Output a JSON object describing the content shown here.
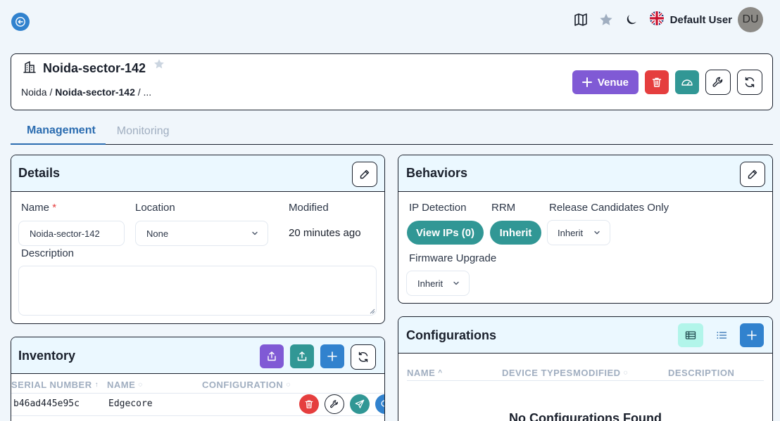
{
  "topbar": {
    "user_name": "Default User",
    "avatar_initials": "DU",
    "icons": [
      "back-icon",
      "map-icon",
      "star-icon",
      "moon-icon",
      "uk-flag-icon"
    ]
  },
  "venue": {
    "title": "Noida-sector-142",
    "breadcrumb": {
      "root": "Noida",
      "sep1": " / ",
      "current": "Noida-sector-142",
      "sep2": " / ",
      "more": "..."
    },
    "add_venue_label": "Venue"
  },
  "tabs": [
    {
      "label": "Management",
      "active": true
    },
    {
      "label": "Monitoring",
      "active": false
    }
  ],
  "details": {
    "title": "Details",
    "name_label": "Name",
    "required_mark": "*",
    "name_value": "Noida-sector-142",
    "location_label": "Location",
    "location_value": "None",
    "modified_label": "Modified",
    "modified_value": "20 minutes ago",
    "description_label": "Description",
    "description_value": ""
  },
  "behaviors": {
    "title": "Behaviors",
    "ip_detection_label": "IP Detection",
    "ip_detection_button": "View IPs (0)",
    "rrm_label": "RRM",
    "rrm_button": "Inherit",
    "release_candidates_label": "Release Candidates Only",
    "release_candidates_value": "Inherit",
    "firmware_upgrade_label": "Firmware Upgrade",
    "firmware_upgrade_value": "Inherit"
  },
  "inventory": {
    "title": "Inventory",
    "columns": [
      "SERIAL NUMBER",
      "NAME",
      "CONFIGURATION"
    ],
    "rows": [
      {
        "serial": "b46ad445e95c",
        "name": "Edgecore",
        "configuration": ""
      }
    ]
  },
  "configurations": {
    "title": "Configurations",
    "columns": [
      "NAME",
      "DEVICE TYPES",
      "MODIFIED",
      "DESCRIPTION"
    ],
    "empty_message": "No Configurations Found"
  },
  "colors": {
    "accent": "#3182ce",
    "purple": "#805ad5",
    "teal": "#319795",
    "danger": "#e53e3e",
    "panel_header": "#ebf8ff",
    "background": "#f0f6fb"
  }
}
